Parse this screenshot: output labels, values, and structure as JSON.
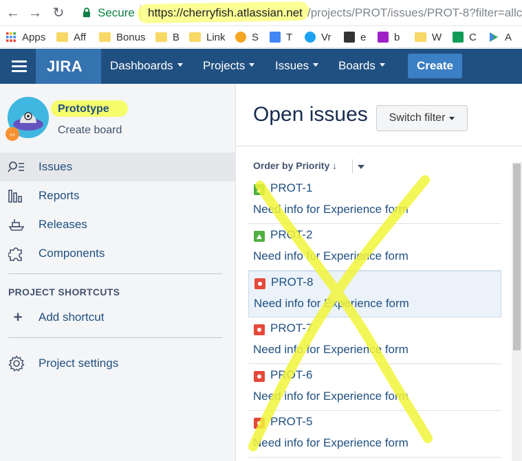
{
  "browser": {
    "secure_label": "Secure",
    "url_host": "https://cherryfish.atlassian.net",
    "url_path": "/projects/PROT/issues/PROT-8?filter=allc",
    "bookmarks": [
      {
        "label": "Apps"
      },
      {
        "label": "Aff"
      },
      {
        "label": "Bonus"
      },
      {
        "label": "B"
      },
      {
        "label": "Link"
      },
      {
        "label": "S"
      },
      {
        "label": "T"
      },
      {
        "label": "Vr"
      },
      {
        "label": "e"
      },
      {
        "label": "b"
      },
      {
        "label": "W"
      },
      {
        "label": "C"
      },
      {
        "label": "A"
      }
    ]
  },
  "header": {
    "logo": "JIRA",
    "nav": [
      {
        "label": "Dashboards"
      },
      {
        "label": "Projects"
      },
      {
        "label": "Issues"
      },
      {
        "label": "Boards"
      }
    ],
    "create_label": "Create"
  },
  "sidebar": {
    "project_name": "Prototype",
    "create_board": "Create board",
    "items": [
      {
        "label": "Issues",
        "icon": "issues-icon",
        "active": true
      },
      {
        "label": "Reports",
        "icon": "reports-icon"
      },
      {
        "label": "Releases",
        "icon": "releases-icon"
      },
      {
        "label": "Components",
        "icon": "components-icon"
      }
    ],
    "shortcuts_heading": "PROJECT SHORTCUTS",
    "add_shortcut": "Add shortcut",
    "project_settings": "Project settings"
  },
  "main": {
    "title": "Open issues",
    "switch_filter": "Switch filter",
    "order_by": "Order by Priority",
    "issues": [
      {
        "key": "PROT-1",
        "summary": "Need info for Experience form",
        "priority": "low"
      },
      {
        "key": "PROT-2",
        "summary": "Need info for Experience form",
        "priority": "low"
      },
      {
        "key": "PROT-8",
        "summary": "Need info for Experience form",
        "priority": "high",
        "selected": true
      },
      {
        "key": "PROT-7",
        "summary": "Need info for Experience form",
        "priority": "high"
      },
      {
        "key": "PROT-6",
        "summary": "Need info for Experience form",
        "priority": "high"
      },
      {
        "key": "PROT-5",
        "summary": "Need info for Experience form",
        "priority": "high"
      }
    ]
  },
  "colors": {
    "header_bg": "#205081",
    "link": "#205081",
    "highlight": "#f7ff3c",
    "priority_high": "#e5493a",
    "priority_low": "#4eb03f"
  }
}
